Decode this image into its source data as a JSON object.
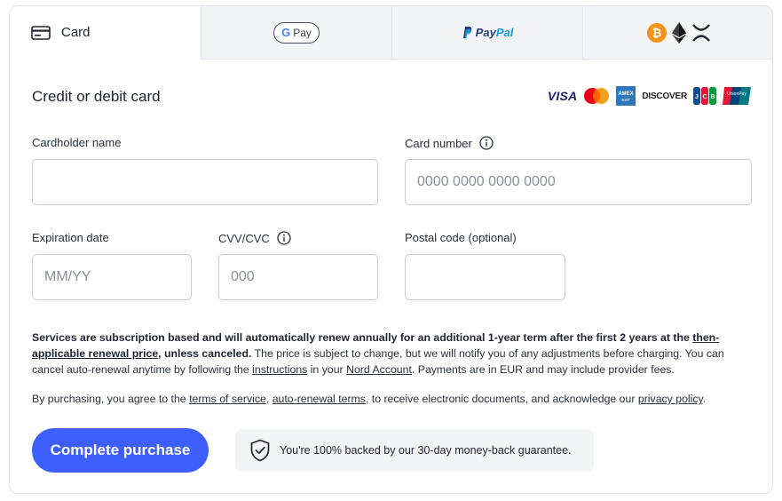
{
  "tabs": [
    {
      "id": "card",
      "label": "Card",
      "icon": "credit-card-icon",
      "active": true
    },
    {
      "id": "gpay",
      "label": "Pay",
      "icon": "google-g-icon"
    },
    {
      "id": "paypal",
      "label_p": "Pay",
      "label_pal": "Pal",
      "icon": "paypal-icon"
    },
    {
      "id": "crypto",
      "icons": [
        "bitcoin-icon",
        "ethereum-icon",
        "xrp-icon"
      ]
    }
  ],
  "form": {
    "title": "Credit or debit card",
    "brands": {
      "visa": "VISA",
      "amex": "AMERICAN EXPRESS",
      "discover": "DISCOVER",
      "jcb": "JCB",
      "unionpay": "UnionPay"
    },
    "cardholder": {
      "label": "Cardholder name",
      "value": "",
      "placeholder": ""
    },
    "card_number": {
      "label": "Card number",
      "value": "",
      "placeholder": "0000 0000 0000 0000"
    },
    "expiration": {
      "label": "Expiration date",
      "value": "",
      "placeholder": "MM/YY"
    },
    "cvv": {
      "label": "CVV/CVC",
      "value": "",
      "placeholder": "000"
    },
    "postal": {
      "label": "Postal code (optional)",
      "value": "",
      "placeholder": ""
    }
  },
  "terms": {
    "bold_1": "Services are subscription based and will automatically renew annually for an additional 1-year term after the first 2 years at the ",
    "link_renewal": "then-applicable renewal price",
    "bold_2": ", unless canceled.",
    "text_1": " The price is subject to change, but we will notify you of any adjustments before charging. You can cancel auto-renewal anytime by following the ",
    "link_instructions": "instructions",
    "text_2": " in your ",
    "link_account": "Nord Account",
    "text_3": ". Payments are in EUR and may include provider fees."
  },
  "agree": {
    "text_1": "By purchasing, you agree to the ",
    "link_tos": "terms of service",
    "text_2": ", ",
    "link_autorenew": "auto-renewal terms",
    "text_3": ", to receive electronic documents, and acknowledge our ",
    "link_privacy": "privacy policy",
    "text_4": "."
  },
  "actions": {
    "purchase_label": "Complete purchase",
    "guarantee_text": "You're 100% backed by our 30-day money-back guarantee."
  },
  "colors": {
    "primary": "#3e5fff",
    "tab_bg": "#f3f4f6",
    "border": "#c9cdd4"
  }
}
